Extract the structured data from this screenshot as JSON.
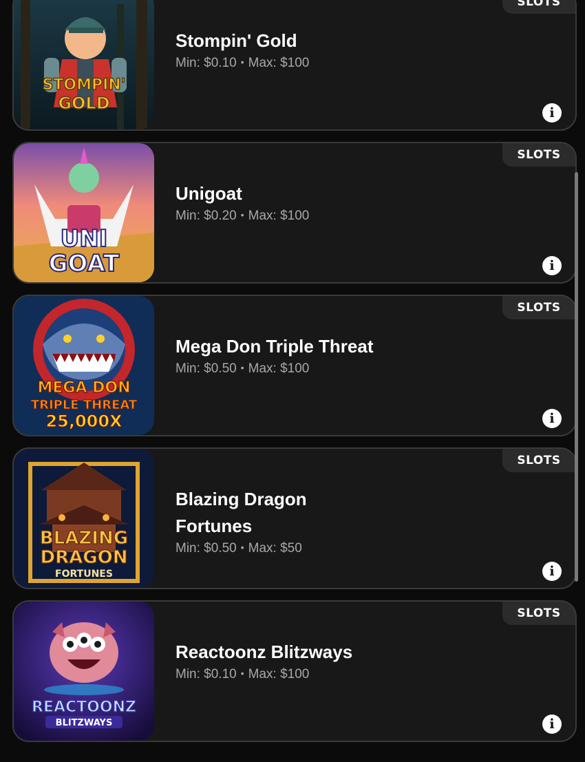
{
  "games": [
    {
      "title": "Stompin' Gold",
      "min_label": "Min: $0.10",
      "separator": "•",
      "max_label": "Max: $100",
      "category": "SLOTS",
      "logo_line1": "STOMPIN'",
      "logo_line2": "GOLD",
      "info_icon": "info-icon"
    },
    {
      "title": "Unigoat",
      "min_label": "Min: $0.20",
      "separator": "•",
      "max_label": "Max: $100",
      "category": "SLOTS",
      "logo_line1": "UNI",
      "logo_line2": "GOAT",
      "info_icon": "info-icon"
    },
    {
      "title": "Mega Don Triple Threat",
      "min_label": "Min: $0.50",
      "separator": "•",
      "max_label": "Max: $100",
      "category": "SLOTS",
      "logo_line1": "MEGA DON",
      "logo_line2": "TRIPLE THREAT",
      "logo_line3": "25,000X",
      "info_icon": "info-icon"
    },
    {
      "title": "Blazing Dragon Fortunes",
      "min_label": "Min: $0.50",
      "separator": "•",
      "max_label": "Max: $50",
      "category": "SLOTS",
      "logo_line1": "BLAZING",
      "logo_line2": "DRAGON",
      "logo_line3": "FORTUNES",
      "info_icon": "info-icon"
    },
    {
      "title": "Reactoonz Blitzways",
      "min_label": "Min: $0.10",
      "separator": "•",
      "max_label": "Max: $100",
      "category": "SLOTS",
      "logo_line1": "REACTOONZ",
      "logo_line2": "BLITZWAYS",
      "info_icon": "info-icon"
    }
  ],
  "info_glyph": "i",
  "colors": {
    "background": "#0b0b0b",
    "card": "#181818",
    "card_border": "#3a3a3a",
    "badge": "#2b2b2b",
    "title": "#ffffff",
    "limits": "#a8a8a8"
  }
}
